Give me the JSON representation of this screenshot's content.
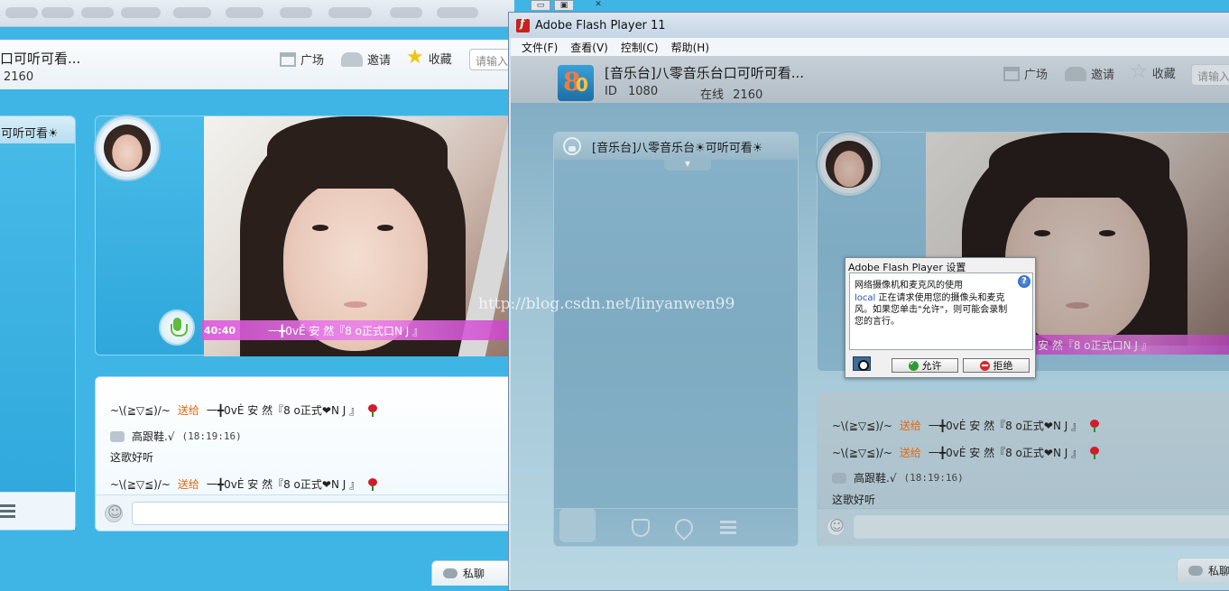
{
  "background_app": {
    "room_title": "口可听可看...",
    "online_count": "2160",
    "nav": {
      "plaza": "广场",
      "invite": "邀请",
      "favorite": "收藏",
      "search_placeholder": "请输入"
    },
    "list_title": "可听可看☀",
    "video": {
      "timer": "40:40",
      "performer": "一╋0vĔ 安 然『8 ο正式口N J 』"
    },
    "chat": [
      {
        "sender": "~\\(≧▽≦)/~",
        "action": "送给",
        "target": "一╋0vĖ 安 然『8 ο正式❤N J 』"
      },
      {
        "sender": "高跟鞋.√",
        "time": "(18:19:16)",
        "text": "这歌好听"
      },
      {
        "sender": "~\\(≧▽≦)/~",
        "action": "送给",
        "target": "一╋0vĖ 安 然『8 ο正式❤N J 』"
      }
    ],
    "private_chat": "私聊"
  },
  "flash_window": {
    "title": "Adobe Flash Player 11",
    "menu": [
      "文件(F)",
      "查看(V)",
      "控制(C)",
      "帮助(H)"
    ],
    "room_title": "[音乐台]八零音乐台口可听可看...",
    "id_label": "ID",
    "id_value": "1080",
    "online_label": "在线",
    "online_value": "2160",
    "nav": {
      "plaza": "广场",
      "invite": "邀请",
      "favorite": "收藏",
      "search_placeholder": "请输入"
    },
    "list_title": "[音乐台]八零音乐台☀可听可看☀",
    "video": {
      "performer": "安 然『8 ο正式口N J 』"
    },
    "chat": [
      {
        "sender": "~\\(≧▽≦)/~",
        "action": "送给",
        "target": "一╋0vĖ 安 然『8 ο正式❤N J 』"
      },
      {
        "sender": "~\\(≧▽≦)/~",
        "action": "送给",
        "target": "一╋0vĖ 安 然『8 ο正式❤N J 』"
      },
      {
        "sender": "高跟鞋.√",
        "time": "(18:19:16)"
      },
      {
        "text": "这歌好听"
      }
    ],
    "private_chat": "私聊"
  },
  "settings_dialog": {
    "title": "Adobe Flash Player 设置",
    "line1": "网络摄像机和麦克风的使用",
    "line2_link": "local",
    "line2_rest": " 正在请求使用您的摄像头和麦克",
    "line3": "风。如果您单击\"允许\"，则可能会录制",
    "line4": "您的言行。",
    "allow": "允许",
    "deny": "拒绝",
    "help": "?"
  },
  "watermark": "http://blog.csdn.net/linyanwen99",
  "colors": {
    "app_blue": "#3fb5e6",
    "gift_orange": "#e06a10",
    "name_bar_magenta": "#dc50dc",
    "flash_red": "#c8221b"
  }
}
